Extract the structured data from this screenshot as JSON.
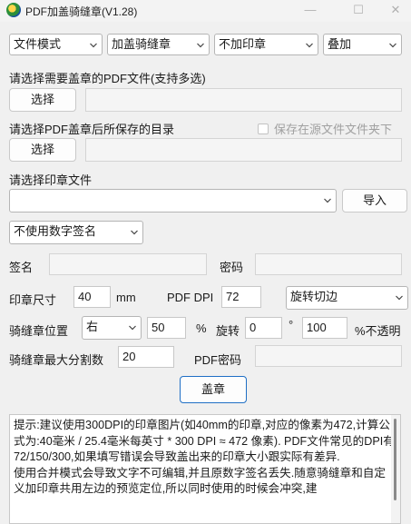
{
  "window": {
    "title": "PDF加盖骑缝章(V1.28)",
    "min_glyph": "—",
    "max_glyph": "☐",
    "close_glyph": "✕"
  },
  "row1": {
    "mode": "文件模式",
    "stamp_type": "加盖骑缝章",
    "seal_option": "不加印章",
    "overlay": "叠加"
  },
  "pdf_select": {
    "label": "请选择需要盖章的PDF文件(支持多选)",
    "button": "选择",
    "path": ""
  },
  "output_dir": {
    "label": "请选择PDF盖章后所保存的目录",
    "checkbox_label": "保存在源文件文件夹下",
    "button": "选择",
    "path": ""
  },
  "seal_file": {
    "label": "请选择印章文件",
    "value": "",
    "import_button": "导入"
  },
  "signature": {
    "mode": "不使用数字签名",
    "sign_label": "签名",
    "sign_value": "",
    "password_label": "密码",
    "password_value": ""
  },
  "size_row": {
    "size_label": "印章尺寸",
    "size_value": "40",
    "size_unit": "mm",
    "dpi_label": "PDF DPI",
    "dpi_value": "72",
    "cut_option": "旋转切边"
  },
  "position_row": {
    "label": "骑缝章位置",
    "side": "右",
    "percent_value": "50",
    "percent_sign": "%",
    "rotate_label": "旋转",
    "rotate_value": "0",
    "degree_sign": "°",
    "opacity_value": "100",
    "opacity_label": "%不透明"
  },
  "split_row": {
    "label": "骑缝章最大分割数",
    "value": "20",
    "pdf_password_label": "PDF密码",
    "pdf_password_value": ""
  },
  "action": {
    "stamp_button": "盖章"
  },
  "hint": {
    "p1": "提示:建议使用300DPI的印章图片(如40mm的印章,对应的像素为472,计算公式为:40毫米 / 25.4毫米每英寸 * 300 DPI ≈ 472 像素). PDF文件常见的DPI有72/150/300,如果填写错误会导致盖出来的印章大小跟实际有差异.",
    "p2": "使用合并模式会导致文字不可编辑,并且原数字签名丢失.随意骑缝章和自定义加印章共用左边的预览定位,所以同时使用的时候会冲突,建"
  }
}
